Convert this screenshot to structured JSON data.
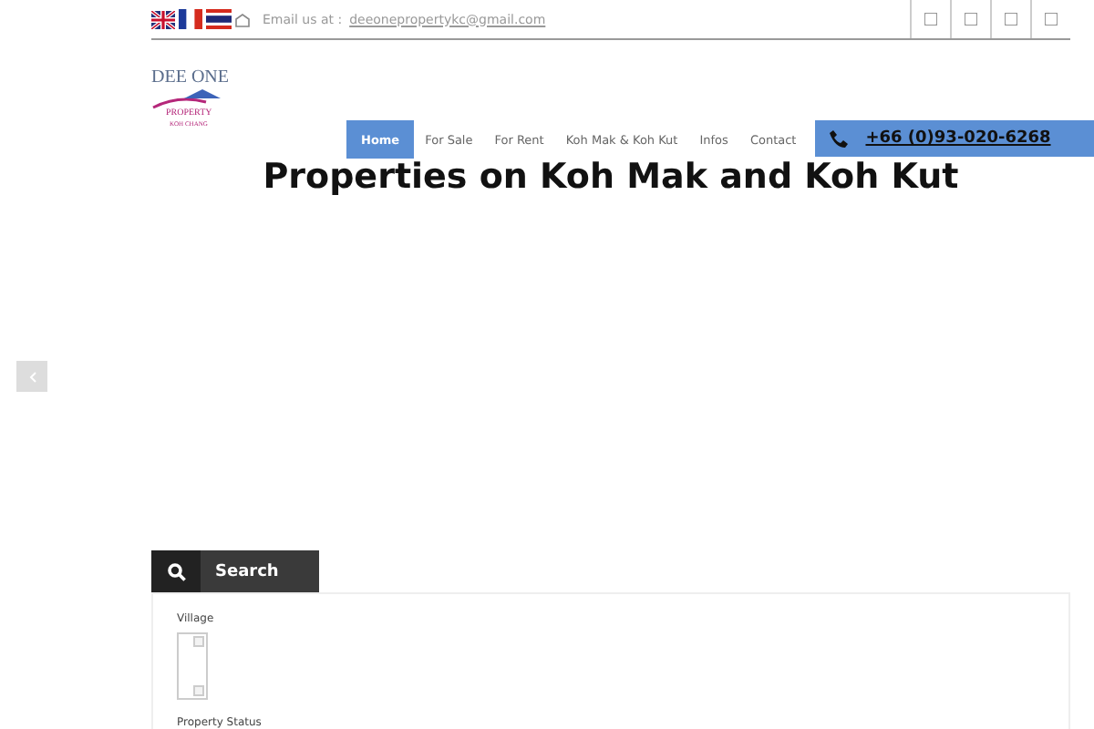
{
  "topbar": {
    "email_label": "Email us at :",
    "email": "deeonepropertykc@gmail.com",
    "flags": [
      {
        "kind": "uk"
      },
      {
        "kind": "france"
      },
      {
        "kind": "thailand"
      }
    ]
  },
  "logo": {
    "name": "DEE ONE",
    "sub": "PROPERTY",
    "place": "KOH CHANG"
  },
  "nav": [
    {
      "label": "Home",
      "selected": true
    },
    {
      "label": "For Sale",
      "selected": false
    },
    {
      "label": "For Rent",
      "selected": false
    },
    {
      "label": "Koh Mak & Koh Kut",
      "selected": false
    },
    {
      "label": "Infos",
      "selected": false
    },
    {
      "label": "Contact",
      "selected": false
    }
  ],
  "phone": "+66 (0)93-020-6268",
  "heading": "Properties on Koh Mak and Koh Kut",
  "search": {
    "title": "Search",
    "fields": [
      {
        "label": "Village",
        "kind": "listbox"
      },
      {
        "label": "Property Status",
        "kind": "label"
      }
    ]
  }
}
